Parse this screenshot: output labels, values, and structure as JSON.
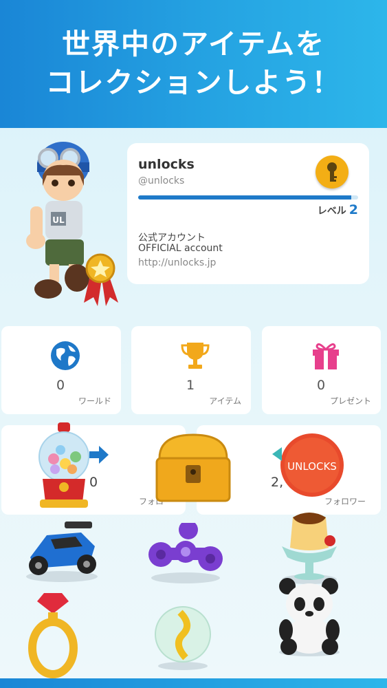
{
  "banner": {
    "line1": "世界中のアイテムを",
    "line2": "コレクションしよう！"
  },
  "profile": {
    "name": "unlocks",
    "handle": "@unlocks",
    "level_label": "レベル",
    "level_value": "2",
    "level_progress": 0.97,
    "description_line1": "公式アカウント",
    "description_line2": "OFFICIAL account",
    "url": "http://unlocks.jp"
  },
  "stats": [
    {
      "icon": "globe-icon",
      "value": "0",
      "label": "ワールド"
    },
    {
      "icon": "trophy-icon",
      "value": "1",
      "label": "アイテム"
    },
    {
      "icon": "gift-icon",
      "value": "0",
      "label": "プレゼント"
    }
  ],
  "follow": {
    "following_value": "0",
    "following_label": "フォロー",
    "followers_value": "2,",
    "followers_label": "フォロワー",
    "badge_text": "UNLOCKS"
  },
  "colors": {
    "banner": "#1a86d6",
    "accent_blue": "#1e7ac9",
    "key_orange": "#f3ae15",
    "gift_pink": "#e73f8c",
    "trophy_yellow": "#f2a81b"
  }
}
